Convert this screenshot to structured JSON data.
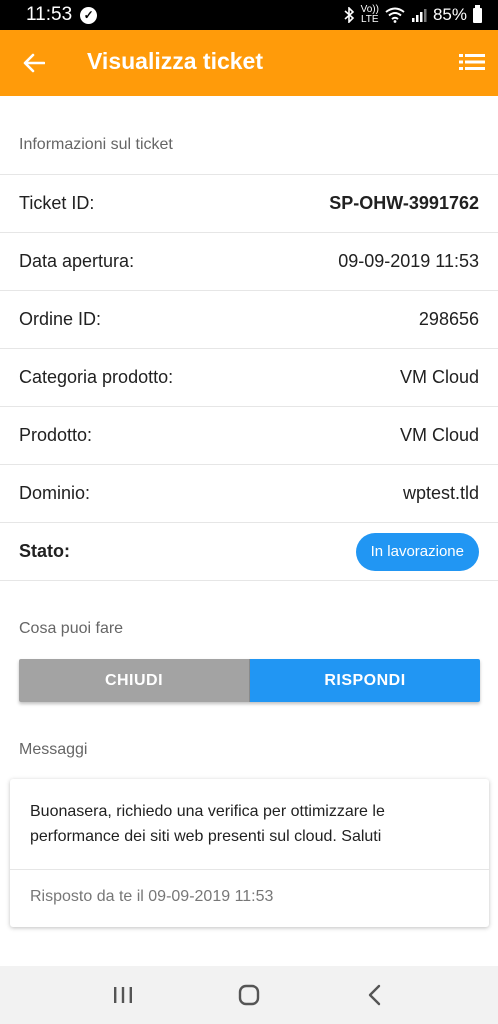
{
  "status_bar": {
    "time": "11:53",
    "volte": "Vo))",
    "lte": "LTE",
    "battery": "85%"
  },
  "app_bar": {
    "title": "Visualizza ticket",
    "back_icon": "arrow-left-icon",
    "menu_icon": "list-icon",
    "color": "#ff9b0a"
  },
  "ticket_info": {
    "section_title": "Informazioni sul ticket",
    "rows": [
      {
        "label": "Ticket ID:",
        "value": "SP-OHW-3991762"
      },
      {
        "label": "Data apertura:",
        "value": "09-09-2019 11:53"
      },
      {
        "label": "Ordine ID:",
        "value": "298656"
      },
      {
        "label": "Categoria prodotto:",
        "value": "VM Cloud"
      },
      {
        "label": "Prodotto:",
        "value": "VM Cloud"
      },
      {
        "label": "Dominio:",
        "value": "wptest.tld"
      }
    ],
    "status": {
      "label": "Stato:",
      "value": "In lavorazione",
      "color": "#2196f3"
    }
  },
  "actions": {
    "section_title": "Cosa puoi fare",
    "close_label": "CHIUDI",
    "reply_label": "RISPONDI"
  },
  "messages": {
    "section_title": "Messaggi",
    "items": [
      {
        "text": "Buonasera, richiedo una verifica per ottimizzare le performance dei siti web presenti sul cloud. Saluti",
        "footer": "Risposto da te il 09-09-2019 11:53"
      }
    ]
  },
  "nav_bar": {
    "recents_icon": "recents-icon",
    "home_icon": "home-icon",
    "back_icon": "back-chevron-icon"
  }
}
